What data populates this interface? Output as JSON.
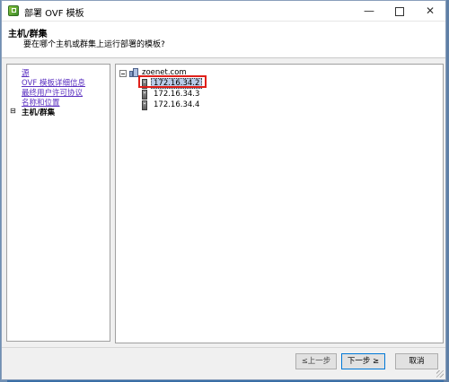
{
  "window": {
    "title": "部署 OVF 模板",
    "controls": {
      "minimize": "—",
      "close": "✕"
    }
  },
  "header": {
    "title": "主机/群集",
    "subtitle": "要在哪个主机或群集上运行部署的模板?"
  },
  "nav": {
    "items": [
      {
        "label": "源"
      },
      {
        "label": "OVF 模板详细信息"
      },
      {
        "label": "最终用户许可协议"
      },
      {
        "label": "名称和位置"
      },
      {
        "label": "主机/群集"
      }
    ],
    "current_marker": "⊟"
  },
  "tree": {
    "root": {
      "label": "zoenet.com"
    },
    "hosts": [
      {
        "label": "172.16.34.2",
        "selected": true
      },
      {
        "label": "172.16.34.3",
        "selected": false
      },
      {
        "label": "172.16.34.4",
        "selected": false
      }
    ]
  },
  "buttons": {
    "prev": "≤上一步",
    "next": "下一步 ≥",
    "cancel": "取消"
  },
  "colors": {
    "link": "#5a2fc0",
    "selection": "#b9cbe8",
    "annotation": "#e0201a",
    "default_button_border": "#0078d7"
  }
}
